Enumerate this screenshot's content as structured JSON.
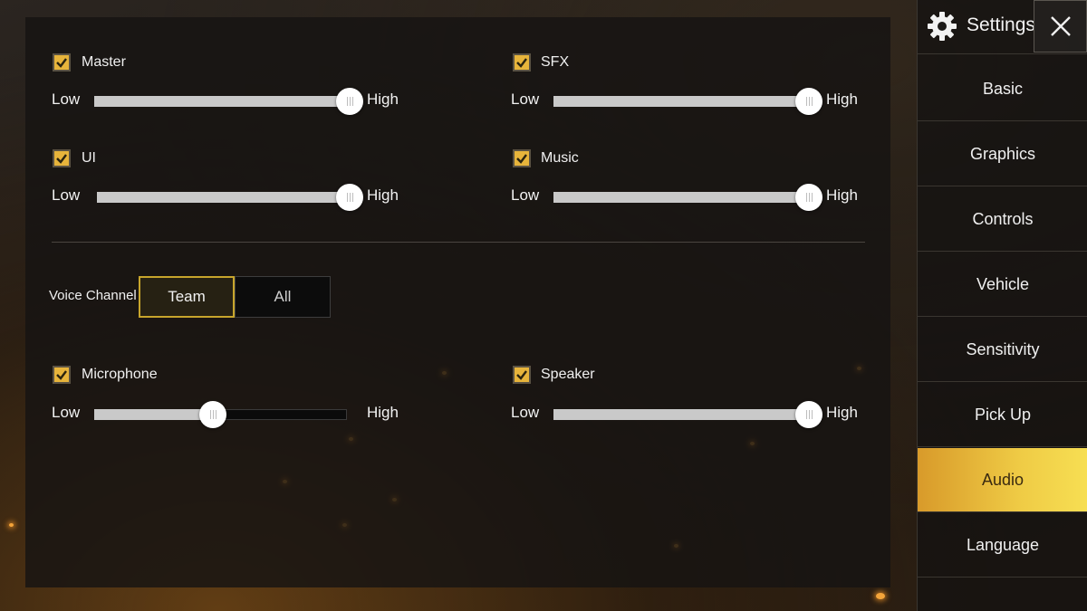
{
  "sidebar": {
    "title": "Settings",
    "items": [
      {
        "label": "Basic",
        "active": false
      },
      {
        "label": "Graphics",
        "active": false
      },
      {
        "label": "Controls",
        "active": false
      },
      {
        "label": "Vehicle",
        "active": false
      },
      {
        "label": "Sensitivity",
        "active": false
      },
      {
        "label": "Pick Up",
        "active": false
      },
      {
        "label": "Audio",
        "active": true
      },
      {
        "label": "Language",
        "active": false
      }
    ]
  },
  "audio": {
    "low_label": "Low",
    "high_label": "High",
    "master": {
      "label": "Master",
      "checked": true,
      "level": 1.0
    },
    "sfx": {
      "label": "SFX",
      "checked": true,
      "level": 1.0
    },
    "ui": {
      "label": "UI",
      "checked": true,
      "level": 1.0
    },
    "music": {
      "label": "Music",
      "checked": true,
      "level": 1.0
    },
    "microphone": {
      "label": "Microphone",
      "checked": true,
      "level": 0.47
    },
    "speaker": {
      "label": "Speaker",
      "checked": true,
      "level": 1.0
    }
  },
  "voice_channel": {
    "label": "Voice Channel",
    "options": [
      "Team",
      "All"
    ],
    "selected": "Team"
  },
  "colors": {
    "accent": "#e7b43b",
    "active_tab_start": "#d89a2a",
    "active_tab_end": "#f7df53"
  }
}
